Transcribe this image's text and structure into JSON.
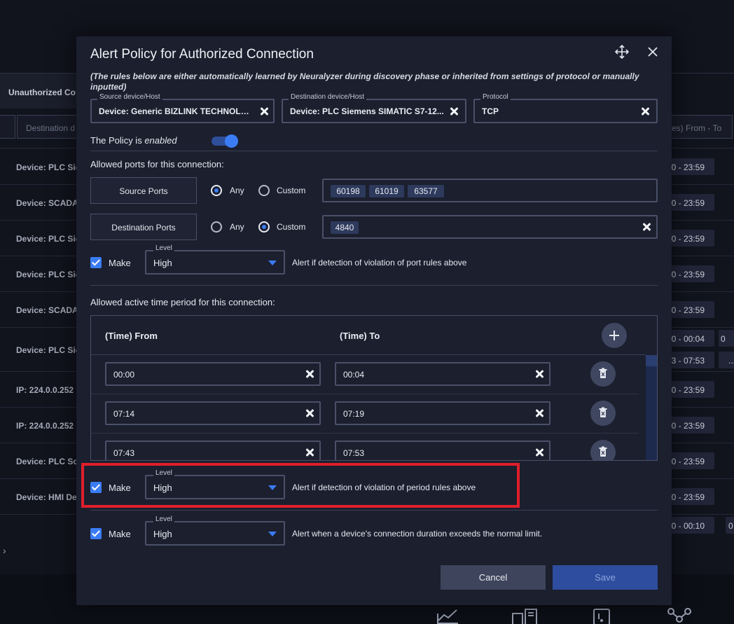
{
  "background": {
    "tab_label": "Unauthorized Co",
    "filter_destination_placeholder": "Destination d",
    "filter_time_placeholder": "es) From - To",
    "rows": [
      {
        "label": "Device: PLC Sie",
        "time": "0 - 23:59"
      },
      {
        "label": "Device: SCADA",
        "time": "0 - 23:59"
      },
      {
        "label": "Device: PLC Sie",
        "time": "0 - 23:59"
      },
      {
        "label": "Device: PLC Sie",
        "time": "0 - 23:59"
      },
      {
        "label": "Device: SCADA",
        "time": "0 - 23:59"
      },
      {
        "label": "Device: PLC Sie",
        "time": "0 - 00:04",
        "time2": "3 - 07:53",
        "extra": "0",
        "extra2": "..."
      },
      {
        "label": "IP: 224.0.0.252",
        "time": "0 - 23:59"
      },
      {
        "label": "IP: 224.0.0.252",
        "time": "0 - 23:59"
      },
      {
        "label": "Device: PLC Sc",
        "time": "0 - 23:59"
      },
      {
        "label": "Device: HMI De",
        "time": "0 - 23:59"
      },
      {
        "label": "",
        "time": "0 - 00:10",
        "extra": "0"
      }
    ]
  },
  "modal": {
    "title": "Alert Policy for Authorized Connection",
    "note": "(The rules below are either automatically learned by Neuralyzer during discovery phase or inherited from settings of protocol or manually inputted)",
    "source": {
      "label": "Source device/Host",
      "value": "Device: Generic BIZLINK TECHNOLO..."
    },
    "destination": {
      "label": "Destination device/Host",
      "value": "Device: PLC Siemens SIMATIC S7-12..."
    },
    "protocol": {
      "label": "Protocol",
      "value": "TCP"
    },
    "policy_prefix": "The Policy is",
    "policy_state": "enabled",
    "ports_heading": "Allowed ports for this connection:",
    "source_ports": {
      "button": "Source Ports",
      "any": "Any",
      "custom": "Custom",
      "selected": "any",
      "chips": [
        "60198",
        "61019",
        "63577"
      ]
    },
    "destination_ports": {
      "button": "Destination Ports",
      "any": "Any",
      "custom": "Custom",
      "selected": "custom",
      "chips": [
        "4840"
      ]
    },
    "port_alert": {
      "make": "Make",
      "level_label": "Level",
      "level": "High",
      "text": "Alert if detection of violation of port rules above"
    },
    "time_heading": "Allowed active time period for this connection:",
    "time_table": {
      "from_header": "(Time) From",
      "to_header": "(Time) To",
      "rows": [
        {
          "from": "00:00",
          "to": "00:04"
        },
        {
          "from": "07:14",
          "to": "07:19"
        },
        {
          "from": "07:43",
          "to": "07:53"
        }
      ]
    },
    "period_alert": {
      "make": "Make",
      "level_label": "Level",
      "level": "High",
      "text": "Alert if detection of violation of period rules above"
    },
    "duration_alert": {
      "make": "Make",
      "level_label": "Level",
      "level": "High",
      "text": "Alert when a device's connection duration exceeds the normal limit."
    },
    "cancel_label": "Cancel",
    "save_label": "Save"
  },
  "colors": {
    "accent": "#3b7cf5",
    "highlight": "#e01e2b",
    "panel": "#1b1f2e",
    "page": "#11131d"
  },
  "icons": [
    "move-icon",
    "close-icon",
    "plus-icon",
    "trash-icon",
    "check-icon",
    "chevron-right-icon",
    "chart-icon",
    "server-icon",
    "device-icon",
    "network-icon"
  ]
}
